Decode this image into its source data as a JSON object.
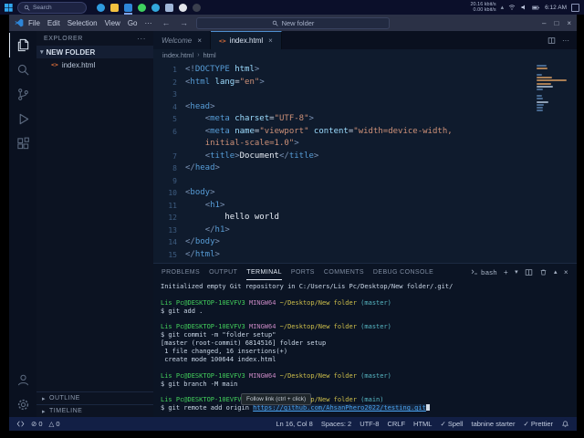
{
  "taskbar": {
    "search_label": "Search",
    "apps": [
      {
        "name": "edge",
        "color": "#2f9be0",
        "round": true
      },
      {
        "name": "file-explorer",
        "color": "#f2c140",
        "round": false
      },
      {
        "name": "vscode",
        "color": "#2e86d8",
        "round": false,
        "active": true
      },
      {
        "name": "whatsapp",
        "color": "#3fd15f",
        "round": true
      },
      {
        "name": "telegram",
        "color": "#32a8dd",
        "round": true
      },
      {
        "name": "word",
        "color": "#9fb6d8",
        "round": false
      },
      {
        "name": "chrome",
        "color": "#e2e5ea",
        "round": true
      },
      {
        "name": "obs",
        "color": "#3a3f4d",
        "round": true
      }
    ],
    "tray": {
      "net_up": "20.16 kbit/s",
      "net_down": "0.00 kbit/s",
      "time": "6:12 AM"
    }
  },
  "titlebar": {
    "menus": [
      "File",
      "Edit",
      "Selection",
      "View",
      "Go"
    ],
    "overflow": "···",
    "search_value": "New folder",
    "window_controls": [
      "–",
      "□",
      "×"
    ]
  },
  "activity": {
    "top": [
      {
        "name": "explorer",
        "active": true
      },
      {
        "name": "search",
        "active": false
      },
      {
        "name": "source-control",
        "active": false
      },
      {
        "name": "run-debug",
        "active": false
      },
      {
        "name": "extensions",
        "active": false
      }
    ],
    "bottom": [
      {
        "name": "account",
        "active": false
      },
      {
        "name": "settings",
        "active": false
      }
    ]
  },
  "sidebar": {
    "title": "EXPLORER",
    "more": "···",
    "folder": "NEW FOLDER",
    "files": [
      {
        "name": "index.html",
        "icon": "html"
      }
    ],
    "bottom": [
      "OUTLINE",
      "TIMELINE"
    ]
  },
  "tabs": [
    {
      "label": "Welcome",
      "active": false,
      "preview": true,
      "icon": ""
    },
    {
      "label": "index.html",
      "active": true,
      "preview": false,
      "icon": "html"
    }
  ],
  "breadcrumb": [
    "index.html",
    "html"
  ],
  "editor": {
    "lines": [
      {
        "n": "1",
        "segs": [
          {
            "c": "p",
            "t": "<!"
          },
          {
            "c": "k",
            "t": "DOCTYPE"
          },
          {
            "c": "a",
            "t": " html"
          },
          {
            "c": "p",
            "t": ">"
          }
        ]
      },
      {
        "n": "2",
        "segs": [
          {
            "c": "p",
            "t": "<"
          },
          {
            "c": "k",
            "t": "html"
          },
          {
            "c": "a",
            "t": " lang"
          },
          {
            "c": "o",
            "t": "="
          },
          {
            "c": "s",
            "t": "\"en\""
          },
          {
            "c": "p",
            "t": ">"
          }
        ]
      },
      {
        "n": "3",
        "segs": []
      },
      {
        "n": "4",
        "segs": [
          {
            "c": "p",
            "t": "<"
          },
          {
            "c": "k",
            "t": "head"
          },
          {
            "c": "p",
            "t": ">"
          }
        ]
      },
      {
        "n": "5",
        "segs": [
          {
            "c": "w",
            "t": "    "
          },
          {
            "c": "p",
            "t": "<"
          },
          {
            "c": "k",
            "t": "meta"
          },
          {
            "c": "a",
            "t": " charset"
          },
          {
            "c": "o",
            "t": "="
          },
          {
            "c": "s",
            "t": "\"UTF-8\""
          },
          {
            "c": "p",
            "t": ">"
          }
        ]
      },
      {
        "n": "6",
        "segs": [
          {
            "c": "w",
            "t": "    "
          },
          {
            "c": "p",
            "t": "<"
          },
          {
            "c": "k",
            "t": "meta"
          },
          {
            "c": "a",
            "t": " name"
          },
          {
            "c": "o",
            "t": "="
          },
          {
            "c": "s",
            "t": "\"viewport\""
          },
          {
            "c": "a",
            "t": " content"
          },
          {
            "c": "o",
            "t": "="
          },
          {
            "c": "s",
            "t": "\"width=device-width,"
          }
        ]
      },
      {
        "n": "",
        "segs": [
          {
            "c": "w",
            "t": "    "
          },
          {
            "c": "s",
            "t": "initial-scale=1.0\""
          },
          {
            "c": "p",
            "t": ">"
          }
        ]
      },
      {
        "n": "7",
        "segs": [
          {
            "c": "w",
            "t": "    "
          },
          {
            "c": "p",
            "t": "<"
          },
          {
            "c": "k",
            "t": "title"
          },
          {
            "c": "p",
            "t": ">"
          },
          {
            "c": "x",
            "t": "Document"
          },
          {
            "c": "p",
            "t": "</"
          },
          {
            "c": "k",
            "t": "title"
          },
          {
            "c": "p",
            "t": ">"
          }
        ]
      },
      {
        "n": "8",
        "segs": [
          {
            "c": "p",
            "t": "</"
          },
          {
            "c": "k",
            "t": "head"
          },
          {
            "c": "p",
            "t": ">"
          }
        ]
      },
      {
        "n": "9",
        "segs": []
      },
      {
        "n": "10",
        "segs": [
          {
            "c": "p",
            "t": "<"
          },
          {
            "c": "k",
            "t": "body"
          },
          {
            "c": "p",
            "t": ">"
          }
        ]
      },
      {
        "n": "11",
        "segs": [
          {
            "c": "w",
            "t": "    "
          },
          {
            "c": "p",
            "t": "<"
          },
          {
            "c": "k",
            "t": "h1"
          },
          {
            "c": "p",
            "t": ">"
          }
        ]
      },
      {
        "n": "12",
        "segs": [
          {
            "c": "w",
            "t": "        "
          },
          {
            "c": "x",
            "t": "hello world"
          }
        ]
      },
      {
        "n": "13",
        "segs": [
          {
            "c": "w",
            "t": "    "
          },
          {
            "c": "p",
            "t": "</"
          },
          {
            "c": "k",
            "t": "h1"
          },
          {
            "c": "p",
            "t": ">"
          }
        ]
      },
      {
        "n": "14",
        "segs": [
          {
            "c": "p",
            "t": "</"
          },
          {
            "c": "k",
            "t": "body"
          },
          {
            "c": "p",
            "t": ">"
          }
        ]
      },
      {
        "n": "15",
        "segs": [
          {
            "c": "p",
            "t": "</"
          },
          {
            "c": "k",
            "t": "html"
          },
          {
            "c": "p",
            "t": ">"
          }
        ]
      }
    ]
  },
  "panel": {
    "tabs": [
      "PROBLEMS",
      "OUTPUT",
      "TERMINAL",
      "PORTS",
      "COMMENTS",
      "DEBUG CONSOLE"
    ],
    "active_tab": "TERMINAL",
    "shell": "bash",
    "tooltip": "Follow link (ctrl + click)",
    "terminal_lines": [
      {
        "segs": [
          {
            "c": "w",
            "t": "Initialized empty Git repository in C:/Users/Lis Pc/Desktop/New folder/.git/"
          }
        ]
      },
      {
        "segs": []
      },
      {
        "segs": [
          {
            "c": "g",
            "t": "Lis Pc@DESKTOP-10EVFV3 "
          },
          {
            "c": "m",
            "t": "MINGW64 "
          },
          {
            "c": "y",
            "t": "~/Desktop/New folder "
          },
          {
            "c": "c",
            "t": "(master)"
          }
        ]
      },
      {
        "segs": [
          {
            "c": "w",
            "t": "$ git add ."
          }
        ]
      },
      {
        "segs": []
      },
      {
        "segs": [
          {
            "c": "g",
            "t": "Lis Pc@DESKTOP-10EVFV3 "
          },
          {
            "c": "m",
            "t": "MINGW64 "
          },
          {
            "c": "y",
            "t": "~/Desktop/New folder "
          },
          {
            "c": "c",
            "t": "(master)"
          }
        ]
      },
      {
        "segs": [
          {
            "c": "w",
            "t": "$ git commit -m \"folder setup\""
          }
        ]
      },
      {
        "segs": [
          {
            "c": "w",
            "t": "[master (root-commit) 6814516] folder setup"
          }
        ]
      },
      {
        "segs": [
          {
            "c": "w",
            "t": " 1 file changed, 16 insertions(+)"
          }
        ]
      },
      {
        "segs": [
          {
            "c": "w",
            "t": " create mode 100644 index.html"
          }
        ]
      },
      {
        "segs": []
      },
      {
        "segs": [
          {
            "c": "g",
            "t": "Lis Pc@DESKTOP-10EVFV3 "
          },
          {
            "c": "m",
            "t": "MINGW64 "
          },
          {
            "c": "y",
            "t": "~/Desktop/New folder "
          },
          {
            "c": "c",
            "t": "(master)"
          }
        ]
      },
      {
        "segs": [
          {
            "c": "w",
            "t": "$ git branch -M main"
          }
        ]
      },
      {
        "segs": []
      },
      {
        "segs": [
          {
            "c": "g",
            "t": "Lis Pc@DESKTOP-10EVFV3 "
          },
          {
            "c": "m",
            "t": "MINGW64 "
          },
          {
            "c": "y",
            "t": "~/Desktop/New folder "
          },
          {
            "c": "c",
            "t": "(main)"
          }
        ]
      },
      {
        "segs": [
          {
            "c": "w",
            "t": "$ git remote add origin "
          },
          {
            "c": "l",
            "t": "https://github.com/AhsanPhero2022/testing.git"
          },
          {
            "c": "cur",
            "t": ""
          }
        ]
      }
    ]
  },
  "status": {
    "errors": "0",
    "warnings": "0",
    "right": [
      "Ln 16, Col 8",
      "Spaces: 2",
      "UTF-8",
      "CRLF",
      "HTML",
      "✓ Spell",
      "tabnine starter",
      "✓ Prettier"
    ]
  }
}
